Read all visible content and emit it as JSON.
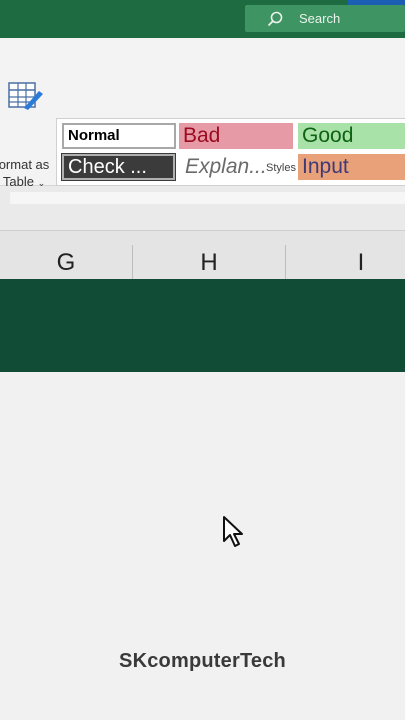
{
  "titlebar": {
    "search_placeholder": "Search"
  },
  "ribbon": {
    "format_as_table": {
      "line1": "ormat as",
      "line2": "Table"
    },
    "cell_styles": [
      {
        "name": "Normal",
        "bg": "#ffffff",
        "fg": "#000000"
      },
      {
        "name": "Bad",
        "bg": "#e59aa6",
        "fg": "#9b0a1e"
      },
      {
        "name": "Good",
        "bg": "#a8e2a8",
        "fg": "#0e6212"
      },
      {
        "name": "Check ...",
        "bg": "#3b3b3b",
        "fg": "#ffffff"
      },
      {
        "name": "Explan...",
        "bg": "#ffffff",
        "fg": "#6a6a6a"
      },
      {
        "name": "Input",
        "bg": "#e8a178",
        "fg": "#3e3a7a"
      }
    ],
    "group_label": "Styles"
  },
  "columns": [
    "G",
    "H",
    "I"
  ],
  "watermark": "SKcomputerTech",
  "colors": {
    "excel_green": "#1e6b42",
    "selection_green": "#114d36"
  }
}
